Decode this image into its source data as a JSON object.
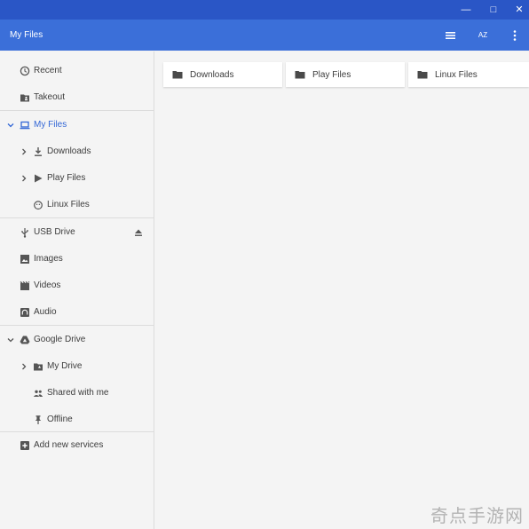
{
  "window": {
    "minimize": "—",
    "restore": "□",
    "close": "✕"
  },
  "toolbar": {
    "title": "My Files",
    "sort_label": "AZ",
    "icons": [
      "list-view-icon",
      "sort-az-icon",
      "more-vert-icon"
    ]
  },
  "sidebar": {
    "items": [
      {
        "label": "Recent",
        "icon": "clock-icon"
      },
      {
        "label": "Takeout",
        "icon": "folder-shared-icon"
      },
      {
        "label": "My Files",
        "icon": "laptop-icon",
        "expanded": true,
        "active": true
      },
      {
        "label": "Downloads",
        "icon": "download-icon"
      },
      {
        "label": "Play Files",
        "icon": "play-icon"
      },
      {
        "label": "Linux Files",
        "icon": "linux-icon"
      },
      {
        "label": "USB Drive",
        "icon": "usb-icon"
      },
      {
        "label": "Images",
        "icon": "image-icon"
      },
      {
        "label": "Videos",
        "icon": "video-icon"
      },
      {
        "label": "Audio",
        "icon": "headphones-icon"
      },
      {
        "label": "Google Drive",
        "icon": "drive-icon",
        "expanded": true
      },
      {
        "label": "My Drive",
        "icon": "folder-shared-icon"
      },
      {
        "label": "Shared with me",
        "icon": "people-icon"
      },
      {
        "label": "Offline",
        "icon": "pin-icon"
      },
      {
        "label": "Add new services",
        "icon": "add-box-icon"
      }
    ]
  },
  "main": {
    "folders": [
      {
        "label": "Downloads"
      },
      {
        "label": "Play Files"
      },
      {
        "label": "Linux Files"
      }
    ]
  },
  "watermark": "奇点手游网",
  "colors": {
    "titlebar": "#2a56c6",
    "toolbar": "#3b6fd9",
    "accent": "#3367d6"
  }
}
